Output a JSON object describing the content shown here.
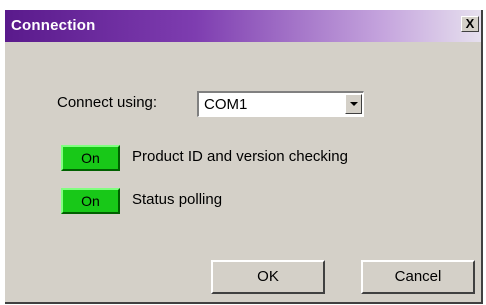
{
  "window": {
    "title": "Connection",
    "close_label": "X",
    "title_gradient": [
      "#5a1a8c",
      "#e6e0ee"
    ]
  },
  "connect_using": {
    "label": "Connect using:",
    "value": "COM1"
  },
  "options": [
    {
      "toggle_label": "On",
      "description": "Product ID and version checking",
      "state_color": "#18c818"
    },
    {
      "toggle_label": "On",
      "description": "Status polling",
      "state_color": "#18c818"
    }
  ],
  "buttons": {
    "ok_label": "OK",
    "cancel_label": "Cancel"
  },
  "icons": {
    "close": "close-icon",
    "dropdown": "chevron-down-icon"
  }
}
